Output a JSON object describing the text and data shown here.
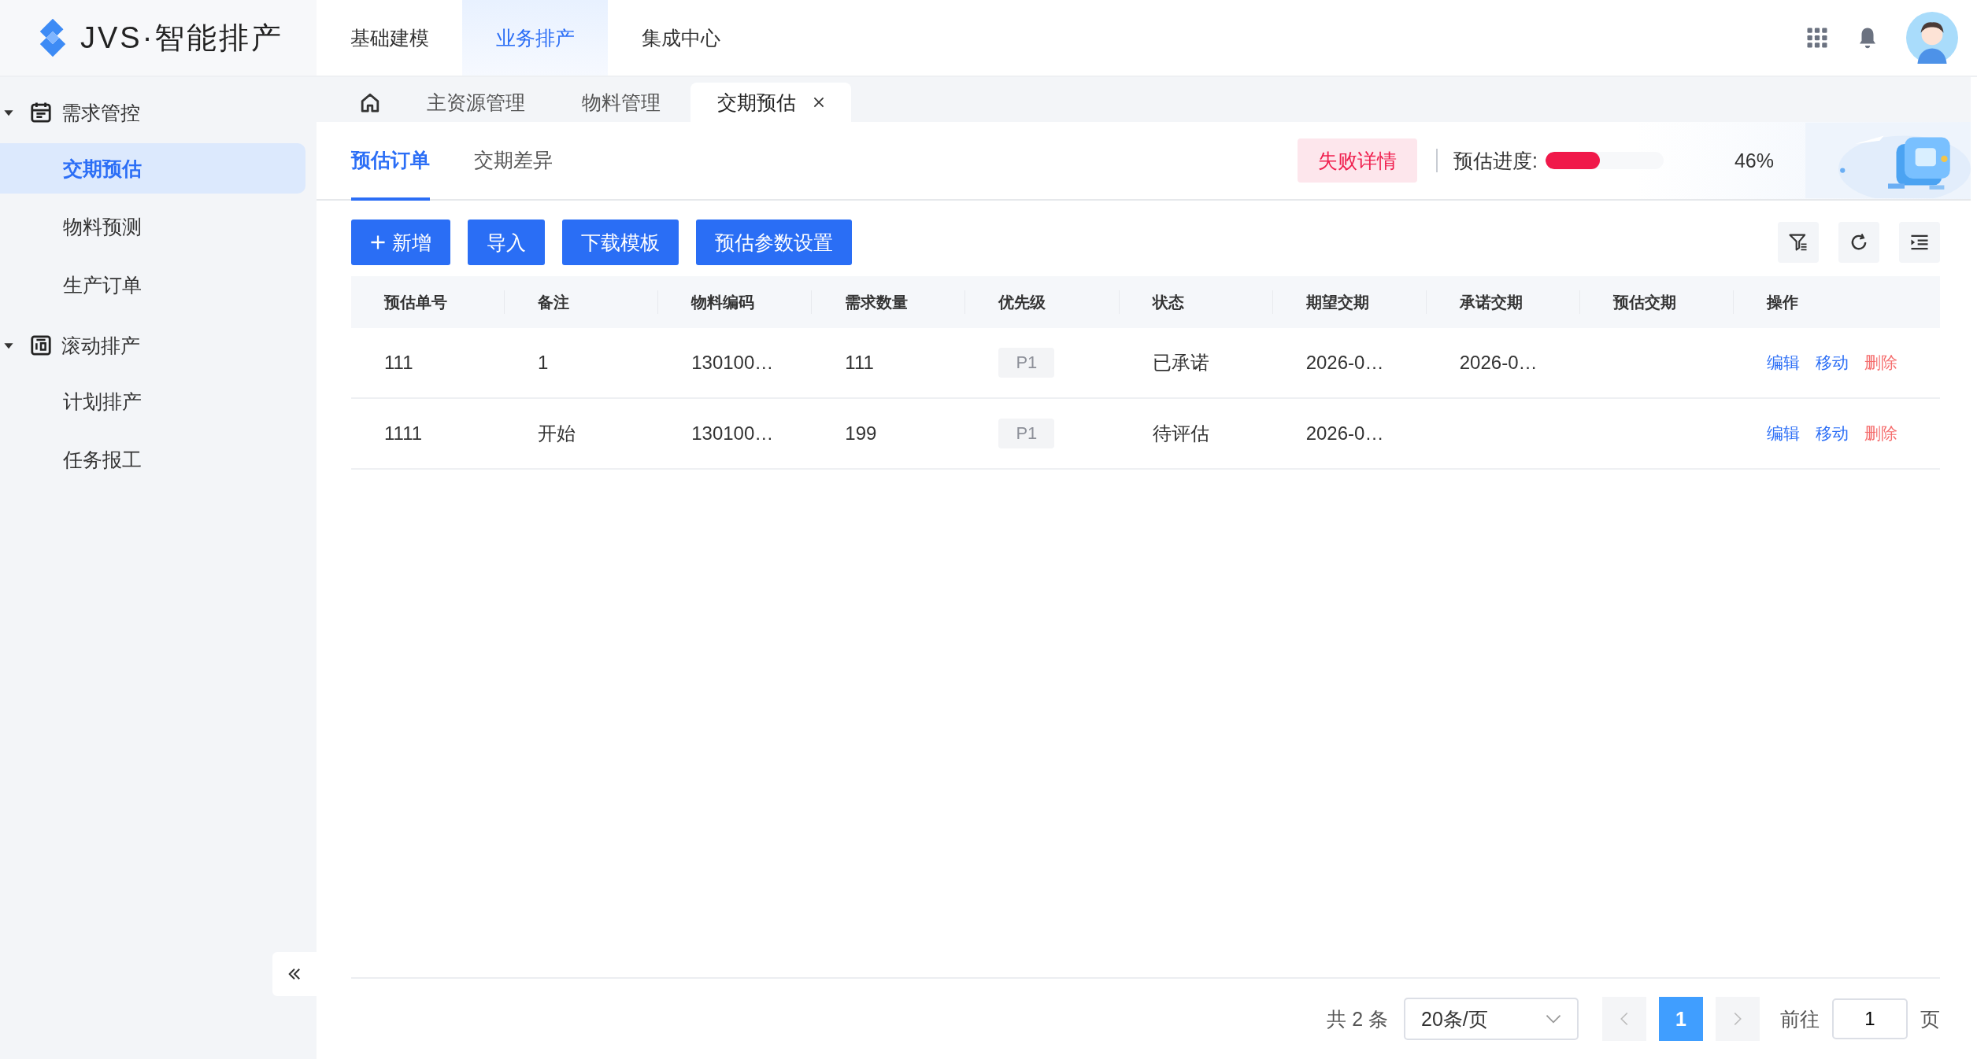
{
  "app": {
    "logo_text": "JVS·智能排产"
  },
  "top_nav": [
    {
      "label": "基础建模",
      "selected": false
    },
    {
      "label": "业务排产",
      "selected": true
    },
    {
      "label": "集成中心",
      "selected": false
    }
  ],
  "sidebar": {
    "groups": [
      {
        "label": "需求管控",
        "expanded": true,
        "children": [
          {
            "label": "交期预估",
            "selected": true
          },
          {
            "label": "物料预测",
            "selected": false
          },
          {
            "label": "生产订单",
            "selected": false
          }
        ]
      },
      {
        "label": "滚动排产",
        "expanded": true,
        "children": [
          {
            "label": "计划排产",
            "selected": false
          },
          {
            "label": "任务报工",
            "selected": false
          }
        ]
      }
    ]
  },
  "page_tabs": [
    {
      "kind": "home",
      "selected": false,
      "closable": false
    },
    {
      "kind": "text",
      "label": "主资源管理",
      "selected": false,
      "closable": false
    },
    {
      "kind": "text",
      "label": "物料管理",
      "selected": false,
      "closable": false
    },
    {
      "kind": "text",
      "label": "交期预估",
      "selected": true,
      "closable": true
    }
  ],
  "sub_tabs": [
    {
      "label": "预估订单",
      "selected": true
    },
    {
      "label": "交期差异",
      "selected": false
    }
  ],
  "failure_button": "失败详情",
  "progress": {
    "label": "预估进度:",
    "level": 0.46,
    "reading": "46%"
  },
  "toolbar_buttons": [
    {
      "kind": "add",
      "label": "新增"
    },
    {
      "kind": "plain",
      "label": "导入"
    },
    {
      "kind": "plain",
      "label": "下载模板"
    },
    {
      "kind": "plain",
      "label": "预估参数设置"
    }
  ],
  "table": {
    "columns": [
      "预估单号",
      "备注",
      "物料编码",
      "需求数量",
      "优先级",
      "状态",
      "期望交期",
      "承诺交期",
      "预估交期",
      "操作"
    ],
    "rows": [
      {
        "order_no": "111",
        "remark": "1",
        "material_code": "130100…",
        "quantity": "111",
        "priority": "P1",
        "status": "已承诺",
        "expected_date": "2026-0…",
        "promised_date": "2026-0…",
        "actions": [
          {
            "label": "编辑",
            "kind": "normal"
          },
          {
            "label": "移动",
            "kind": "normal"
          },
          {
            "label": "删除",
            "kind": "danger"
          }
        ]
      },
      {
        "order_no": "1111",
        "remark": "开始",
        "material_code": "130100…",
        "quantity": "199",
        "priority": "P1",
        "status": "待评估",
        "expected_date": "2026-0…",
        "actions": [
          {
            "label": "编辑",
            "kind": "normal"
          },
          {
            "label": "移动",
            "kind": "normal"
          },
          {
            "label": "删除",
            "kind": "danger"
          }
        ]
      }
    ]
  },
  "pagination": {
    "total": "共 2 条",
    "page_size": "20条/页",
    "pages": [
      {
        "label": "1",
        "selected": true
      }
    ],
    "goto_label": "前往",
    "goto_value": "1",
    "page_suffix": "页"
  }
}
